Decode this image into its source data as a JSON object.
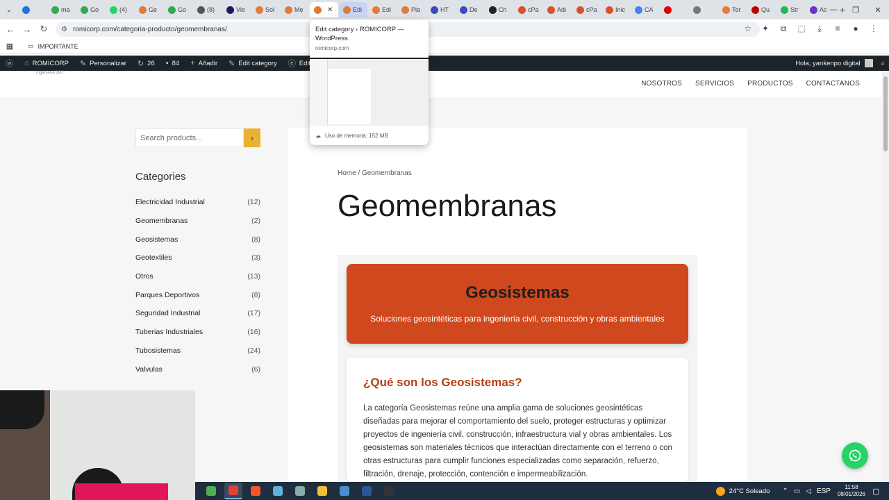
{
  "browser": {
    "tabs": [
      {
        "label": "",
        "color": "#1a73e8",
        "state": "normal"
      },
      {
        "label": "ma",
        "color": "#34a853",
        "state": "normal"
      },
      {
        "label": "Go",
        "color": "#34a853",
        "state": "normal"
      },
      {
        "label": "(4)",
        "color": "#25d366",
        "state": "normal"
      },
      {
        "label": "Ge",
        "color": "#e07b39",
        "state": "normal"
      },
      {
        "label": "Go",
        "color": "#34a853",
        "state": "normal"
      },
      {
        "label": "(8)",
        "color": "#555555",
        "state": "normal"
      },
      {
        "label": "Vie",
        "color": "#1a1a5e",
        "state": "normal"
      },
      {
        "label": "Sol",
        "color": "#e07b39",
        "state": "normal"
      },
      {
        "label": "Me",
        "color": "#e07b39",
        "state": "normal"
      },
      {
        "label": "",
        "color": "#e07b39",
        "state": "active"
      },
      {
        "label": "Edi",
        "color": "#e07b39",
        "state": "hover"
      },
      {
        "label": "Edi",
        "color": "#e07b39",
        "state": "normal"
      },
      {
        "label": "Pla",
        "color": "#e07b39",
        "state": "normal"
      },
      {
        "label": "HT",
        "color": "#3b4cc0",
        "state": "normal"
      },
      {
        "label": "De",
        "color": "#3b4cc0",
        "state": "normal"
      },
      {
        "label": "Ch",
        "color": "#222222",
        "state": "normal"
      },
      {
        "label": "cPa",
        "color": "#d9512c",
        "state": "normal"
      },
      {
        "label": "Adi",
        "color": "#d9512c",
        "state": "normal"
      },
      {
        "label": "cPa",
        "color": "#d9512c",
        "state": "normal"
      },
      {
        "label": "Inic",
        "color": "#d9512c",
        "state": "normal"
      },
      {
        "label": "CA",
        "color": "#4285f4",
        "state": "normal"
      },
      {
        "label": "",
        "color": "#e00000",
        "state": "normal"
      },
      {
        "label": "",
        "color": "#777777",
        "state": "normal"
      },
      {
        "label": "Ter",
        "color": "#e07b39",
        "state": "normal"
      },
      {
        "label": "Qu",
        "color": "#c00000",
        "state": "normal"
      },
      {
        "label": "Str",
        "color": "#1db954",
        "state": "normal"
      },
      {
        "label": "Ac",
        "color": "#6a32c9",
        "state": "normal"
      }
    ],
    "url": "romicorp.com/categoria-producto/geomembranas/",
    "bookmark_folder": "IMPORTANTE"
  },
  "tab_preview": {
    "title": "Edit category ‹ ROMICORP — WordPress",
    "domain": "romicorp.com",
    "memory": "Uso de memoria: 152 MB"
  },
  "adminbar": {
    "site_name": "ROMICORP",
    "customize": "Personalizar",
    "updates": "26",
    "comments": "84",
    "new": "Añadir",
    "edit_category": "Edit category",
    "edit_with": "Editar con Ele",
    "greeting": "Hola, yankenpo digital"
  },
  "site": {
    "tagline": "Ingeniería 360°",
    "nav": [
      "NOSOTROS",
      "SERVICIOS",
      "PRODUCTOS",
      "CONTACTANOS"
    ]
  },
  "sidebar": {
    "search_placeholder": "Search products...",
    "categories_title": "Categories",
    "categories": [
      {
        "name": "Electricidad Industrial",
        "count": "(12)"
      },
      {
        "name": "Geomembranas",
        "count": "(2)"
      },
      {
        "name": "Geosistemas",
        "count": "(8)"
      },
      {
        "name": "Geotextiles",
        "count": "(3)"
      },
      {
        "name": "Otros",
        "count": "(13)"
      },
      {
        "name": "Parques Deportivos",
        "count": "(8)"
      },
      {
        "name": "Seguridad Industrial",
        "count": "(17)"
      },
      {
        "name": "Tuberias Industriales",
        "count": "(16)"
      },
      {
        "name": "Tubosistemas",
        "count": "(24)"
      },
      {
        "name": "Valvulas",
        "count": "(6)"
      }
    ]
  },
  "main": {
    "breadcrumb": "Home / Geomembranas",
    "title": "Geomembranas",
    "hero_title": "Geosistemas",
    "hero_subtitle": "Soluciones geosintéticas para ingeniería civil, construcción y obras ambientales",
    "section_title": "¿Qué son los Geosistemas?",
    "section_text": "La categoría Geosistemas reúne una amplia gama de soluciones geosintéticas diseñadas para mejorar el comportamiento del suelo, proteger estructuras y optimizar proyectos de ingeniería civil, construcción, infraestructura vial y obras ambientales. Los geosistemas son materiales técnicos que interactúan directamente con el terreno o con otras estructuras para cumplir funciones especializadas como separación, refuerzo, filtración, drenaje, protección, contención e impermeabilización."
  },
  "taskbar": {
    "apps": [
      {
        "name": "app-icon",
        "color": "#4caf50"
      },
      {
        "name": "chrome-icon",
        "color": "#db4437",
        "active": true
      },
      {
        "name": "brave-icon",
        "color": "#fb542b"
      },
      {
        "name": "notepad-icon",
        "color": "#5fb3d9"
      },
      {
        "name": "settings-app-icon",
        "color": "#8aa"
      },
      {
        "name": "folder-icon",
        "color": "#f2c037"
      },
      {
        "name": "steam-icon",
        "color": "#4a8fd0"
      },
      {
        "name": "word-icon",
        "color": "#2b5797"
      },
      {
        "name": "record-icon",
        "color": "#333333"
      }
    ],
    "weather": "24°C Soleado",
    "language": "ESP",
    "time": "11:58",
    "date": "08/01/2026"
  },
  "colors": {
    "accent_orange": "#d0481e",
    "heading_orange": "#b73d12",
    "search_button": "#e9b233",
    "whatsapp": "#25d366",
    "admin_bar": "#1d2327"
  }
}
